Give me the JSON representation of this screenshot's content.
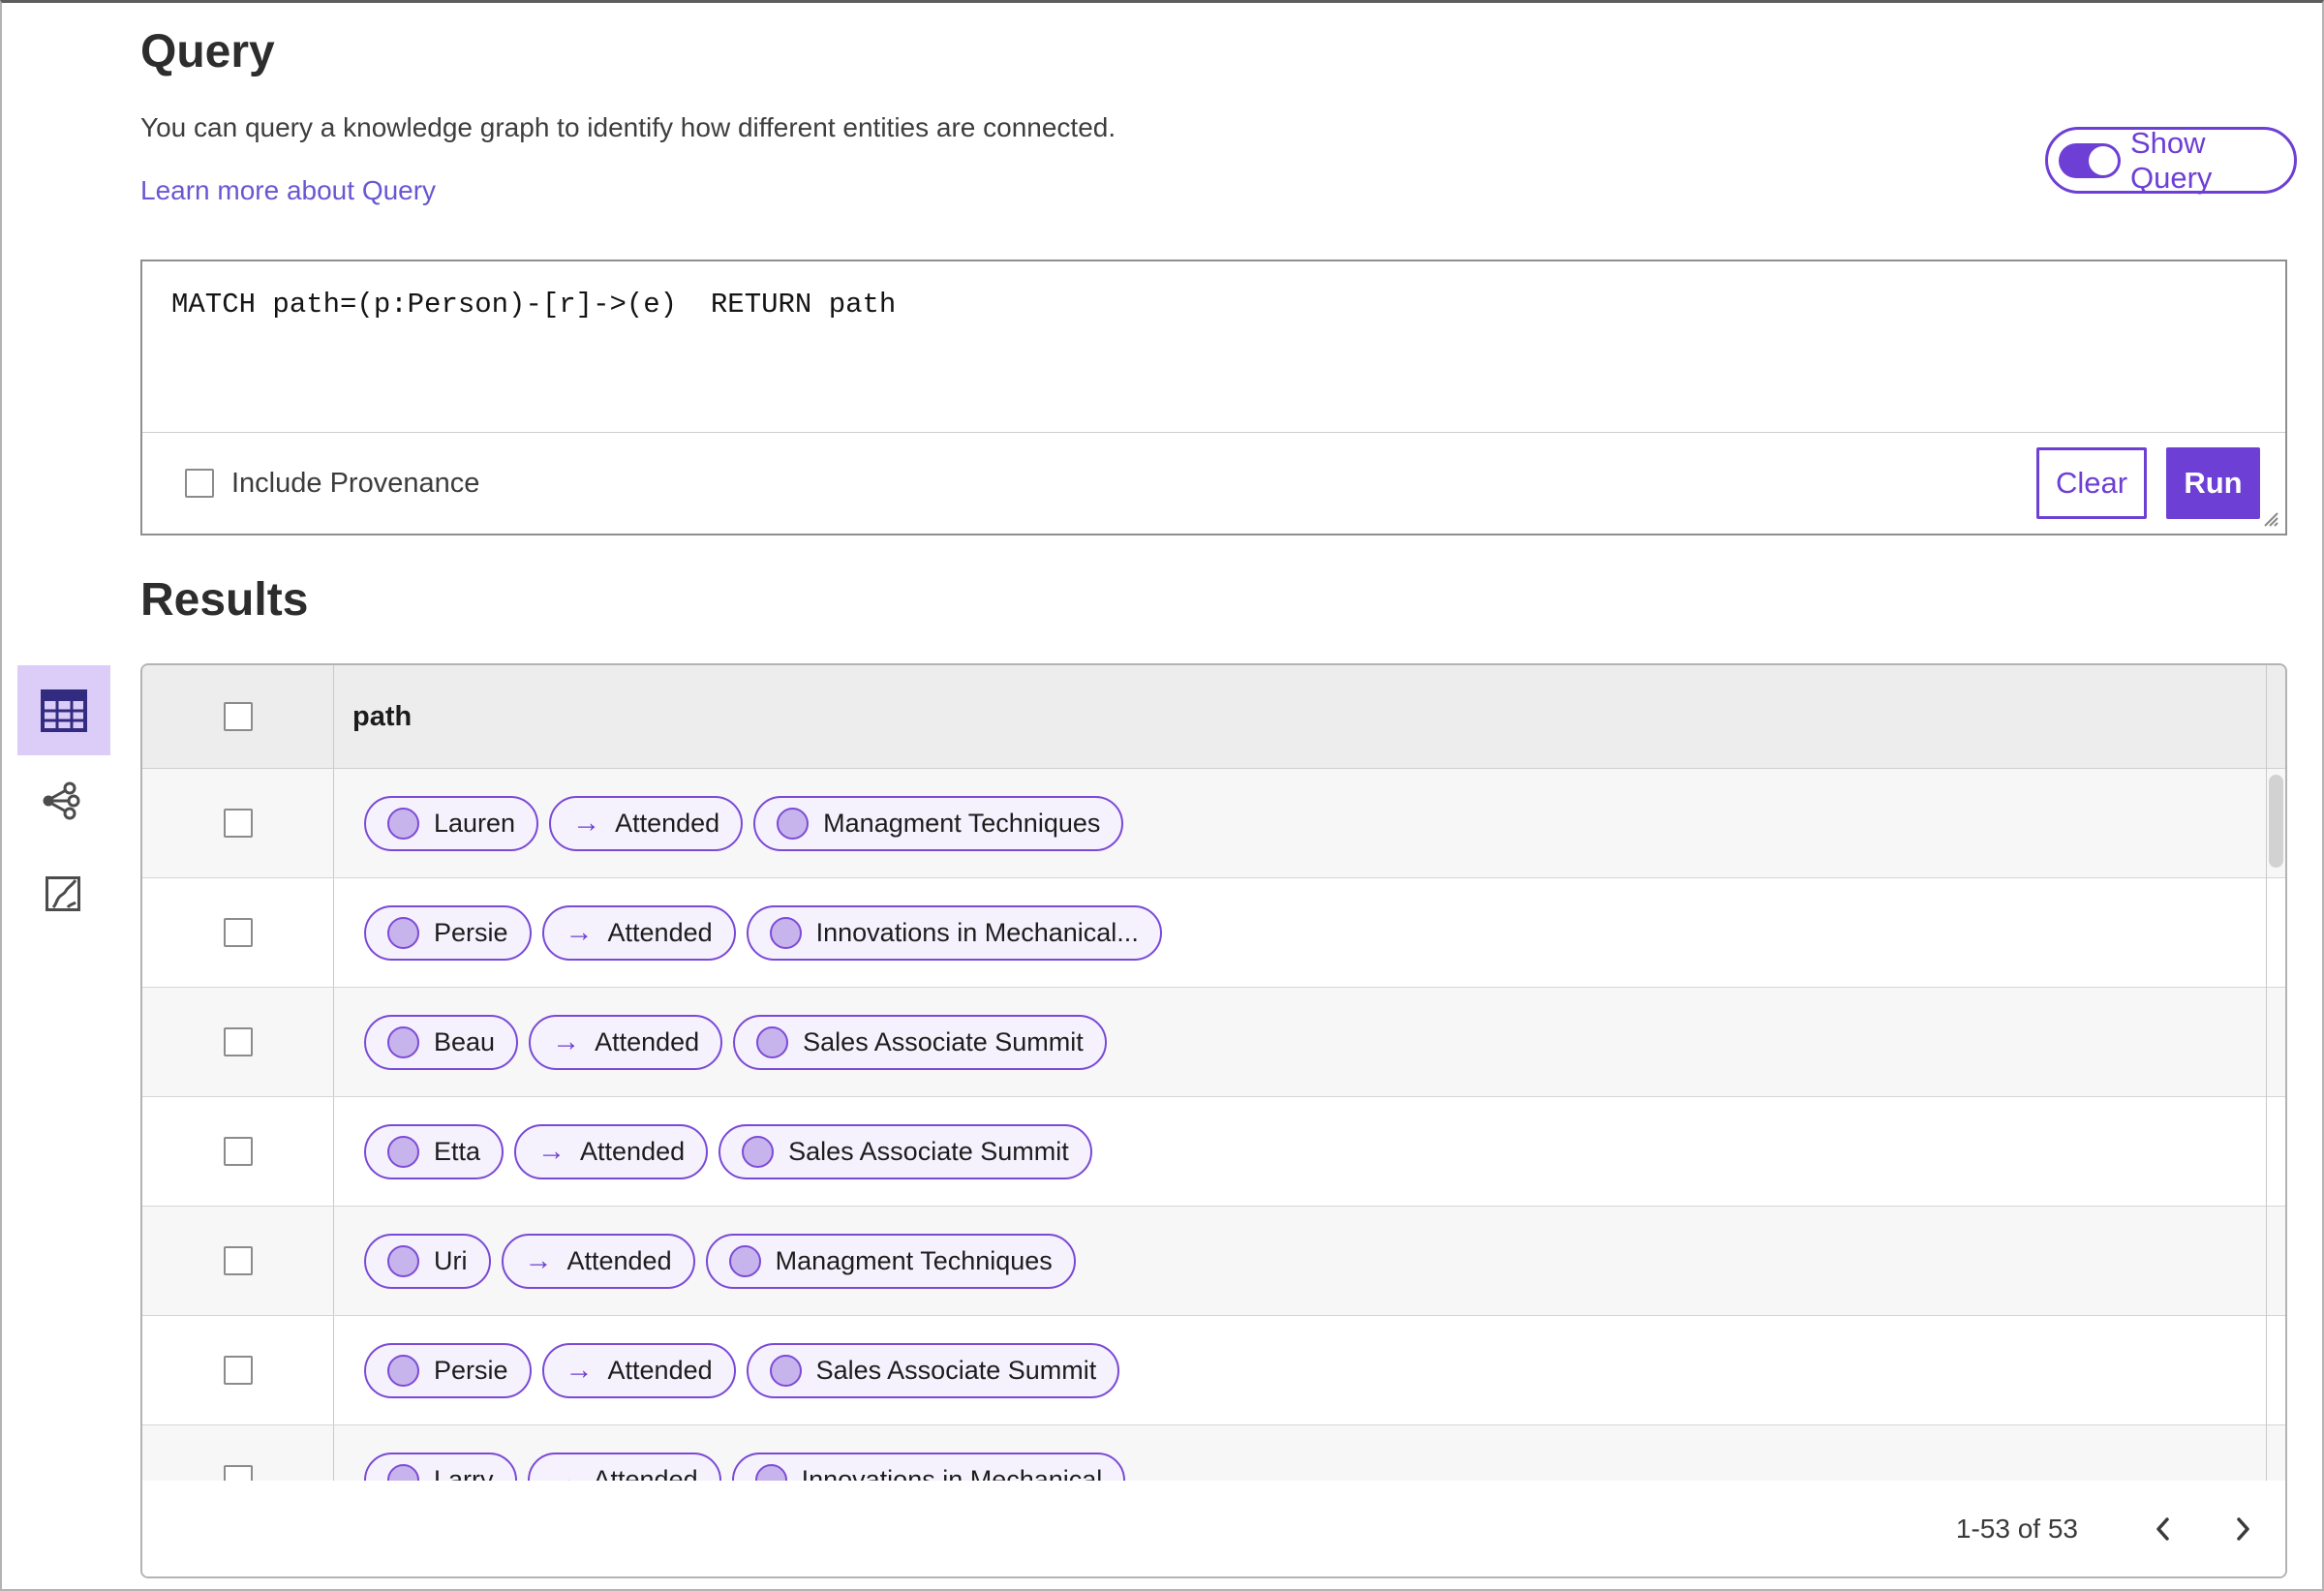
{
  "page": {
    "title": "Query",
    "description": "You can query a knowledge graph to identify how different entities are connected.",
    "learn_more_label": "Learn more about Query",
    "show_query_label": "Show Query",
    "show_query_state": "on"
  },
  "query_editor": {
    "text": "MATCH path=(p:Person)-[r]->(e)  RETURN path",
    "include_provenance_label": "Include Provenance",
    "include_provenance_checked": false,
    "clear_label": "Clear",
    "run_label": "Run"
  },
  "results": {
    "heading": "Results",
    "column_header": "path",
    "arrow": "→",
    "rows": [
      {
        "source": "Lauren",
        "edge": "Attended",
        "target": "Managment Techniques"
      },
      {
        "source": "Persie",
        "edge": "Attended",
        "target": "Innovations in Mechanical..."
      },
      {
        "source": "Beau",
        "edge": "Attended",
        "target": "Sales Associate Summit"
      },
      {
        "source": "Etta",
        "edge": "Attended",
        "target": "Sales Associate Summit"
      },
      {
        "source": "Uri",
        "edge": "Attended",
        "target": "Managment Techniques"
      },
      {
        "source": "Persie",
        "edge": "Attended",
        "target": "Sales Associate Summit"
      },
      {
        "source": "Larry",
        "edge": "Attended",
        "target": "Innovations in Mechanical"
      }
    ],
    "pagination": {
      "label": "1-53 of 53"
    }
  },
  "icons": {
    "view_table": "table-view-icon",
    "view_graph": "graph-view-icon",
    "view_chart": "chart-view-icon",
    "prev": "chevron-left-icon",
    "next": "chevron-right-icon",
    "resize": "resize-handle-icon"
  },
  "colors": {
    "accent": "#6d3fd4",
    "pill_border": "#7a49d6",
    "pill_background": "#f5f2fd",
    "node_circle": "#c8b4ec",
    "selected_tile_background": "#dccdf8",
    "selected_tile_icon": "#322c80",
    "link": "#6857d3"
  }
}
